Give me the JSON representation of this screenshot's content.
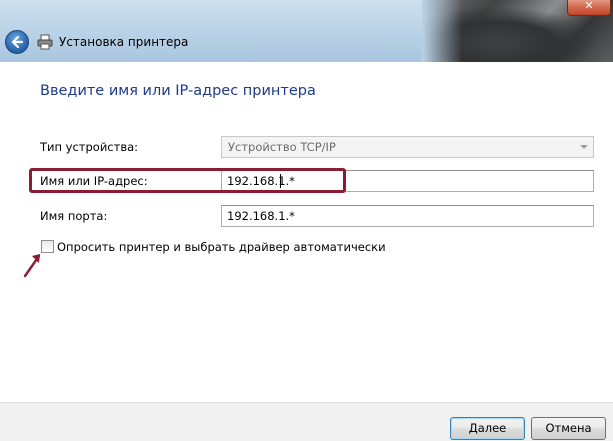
{
  "window": {
    "title": "Установка принтера"
  },
  "main": {
    "heading": "Введите имя или IP-адрес принтера",
    "device_type": {
      "label": "Тип устройства:",
      "value": "Устройство TCP/IP"
    },
    "host": {
      "label": "Имя или IP-адрес:",
      "value": "192.168.1.*"
    },
    "port": {
      "label": "Имя порта:",
      "value": "192.168.1.*"
    },
    "auto_detect": {
      "label": "Опросить принтер и выбрать драйвер автоматически",
      "checked": false
    }
  },
  "footer": {
    "next_label": "Далее",
    "cancel_label": "Отмена"
  },
  "colors": {
    "heading": "#1f3a8a",
    "highlight": "#8c1c34"
  },
  "icons": [
    "back-arrow-icon",
    "printer-icon",
    "close-icon",
    "chevron-down-icon",
    "annotation-arrow-icon"
  ]
}
